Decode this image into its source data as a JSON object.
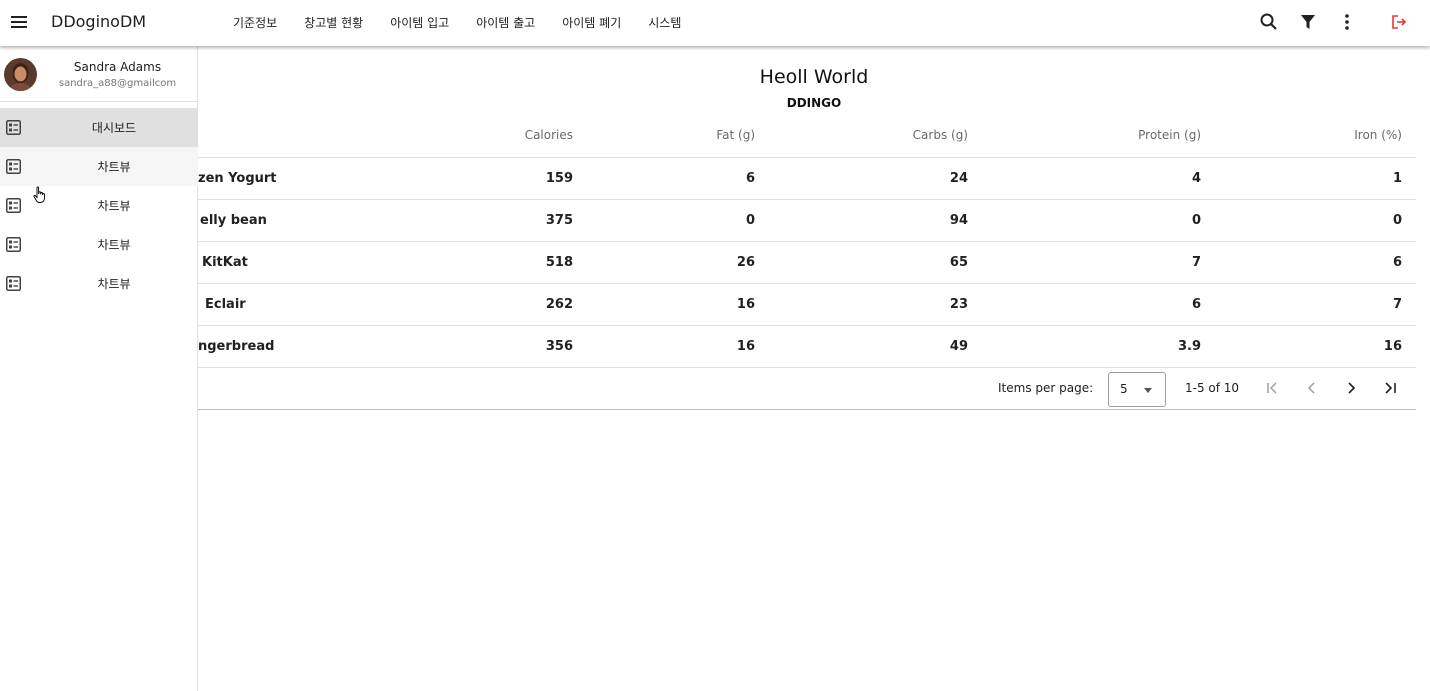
{
  "app": {
    "title": "DDoginoDM"
  },
  "nav": [
    {
      "label": "기준정보"
    },
    {
      "label": "창고별 현황"
    },
    {
      "label": "아이템 입고"
    },
    {
      "label": "아이템 출고"
    },
    {
      "label": "아이템 폐기"
    },
    {
      "label": "시스템"
    }
  ],
  "toolbar_icons": [
    "search-icon",
    "filter-icon",
    "more-vert-icon",
    "logout-icon"
  ],
  "colors": {
    "logout_icon": "#e53935",
    "active_item_bg": "#e0e0e0",
    "hover_item_bg": "#f5f5f5"
  },
  "drawer": {
    "user": {
      "name": "Sandra Adams",
      "email": "sandra_a88@gmailcom"
    },
    "items": [
      {
        "label": "대시보드",
        "state": "active"
      },
      {
        "label": "차트뷰",
        "state": "hover"
      },
      {
        "label": "차트뷰",
        "state": "normal"
      },
      {
        "label": "차트뷰",
        "state": "normal"
      },
      {
        "label": "차트뷰",
        "state": "normal"
      }
    ]
  },
  "page": {
    "title": "Heoll World",
    "subtitle": "DDINGO"
  },
  "table": {
    "headers": {
      "calories": "Calories",
      "fat": "Fat (g)",
      "carbs": "Carbs (g)",
      "protein": "Protein (g)",
      "iron": "Iron (%)"
    },
    "rows": [
      {
        "name": "zen Yogurt",
        "calories": "159",
        "fat": "6",
        "carbs": "24",
        "protein": "4",
        "iron": "1"
      },
      {
        "name": "elly bean",
        "calories": "375",
        "fat": "0",
        "carbs": "94",
        "protein": "0",
        "iron": "0"
      },
      {
        "name": "KitKat",
        "calories": "518",
        "fat": "26",
        "carbs": "65",
        "protein": "7",
        "iron": "6"
      },
      {
        "name": "Eclair",
        "calories": "262",
        "fat": "16",
        "carbs": "23",
        "protein": "6",
        "iron": "7"
      },
      {
        "name": "ngerbread",
        "calories": "356",
        "fat": "16",
        "carbs": "49",
        "protein": "3.9",
        "iron": "16"
      }
    ]
  },
  "pagination": {
    "items_per_page_label": "Items per page:",
    "items_per_page": "5",
    "range": "1-5 of 10"
  }
}
